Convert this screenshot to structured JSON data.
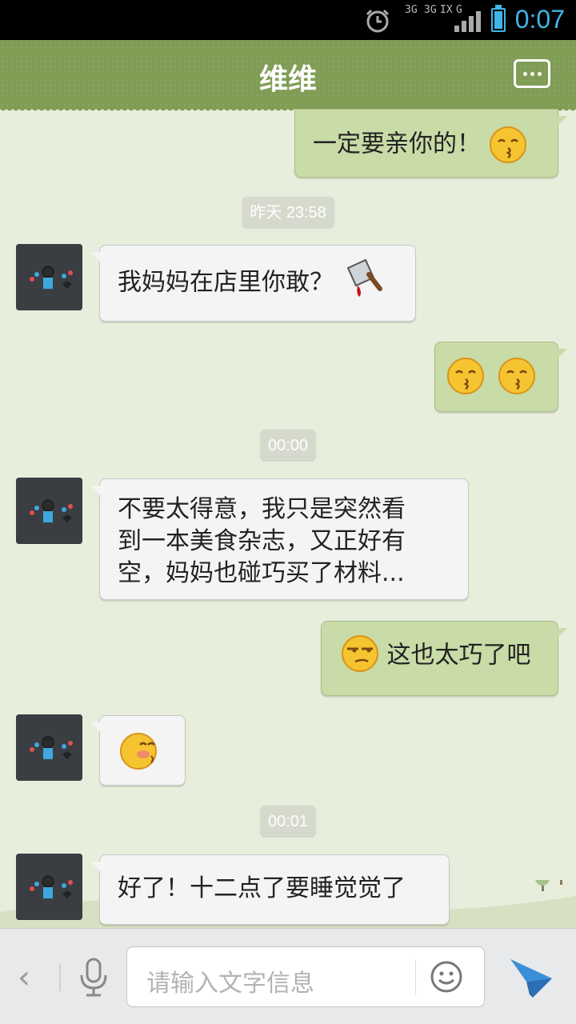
{
  "status_bar": {
    "time": "0:07",
    "network_1": "3G",
    "network_2": "3G",
    "network_3": "IX",
    "network_4": "G",
    "battery_level": 0.85
  },
  "header": {
    "title": "维维"
  },
  "messages": [
    {
      "side": "out",
      "text": "一定要亲你的！",
      "emoji": "kiss-emoji"
    },
    {
      "type": "time",
      "text": "昨天 23:58"
    },
    {
      "side": "in",
      "text": "我妈妈在店里你敢？",
      "emoji": "cleaver-emoji"
    },
    {
      "side": "out",
      "text": "",
      "emoji": "kiss-emoji kiss-emoji"
    },
    {
      "type": "time",
      "text": "00:00"
    },
    {
      "side": "in",
      "text_lines": [
        "不要太得意，我只是突然看",
        "到一本美食杂志，又正好有",
        "空，妈妈也碰巧买了材料..."
      ]
    },
    {
      "side": "out",
      "text": "这也太巧了吧",
      "emoji": "smug-emoji"
    },
    {
      "side": "in",
      "text": "",
      "emoji": "shy-emoji"
    },
    {
      "type": "time",
      "text": "00:01"
    },
    {
      "side": "in",
      "text": "好了！十二点了要睡觉觉了"
    }
  ],
  "input_bar": {
    "back": "‹",
    "placeholder": "请输入文字信息"
  },
  "colors": {
    "title_bar": "#809d55",
    "chat_bg": "#e7eedc",
    "out_bubble": "#c9dba6",
    "in_bubble": "#f4f4f4",
    "accent_blue": "#3fb6e8"
  }
}
